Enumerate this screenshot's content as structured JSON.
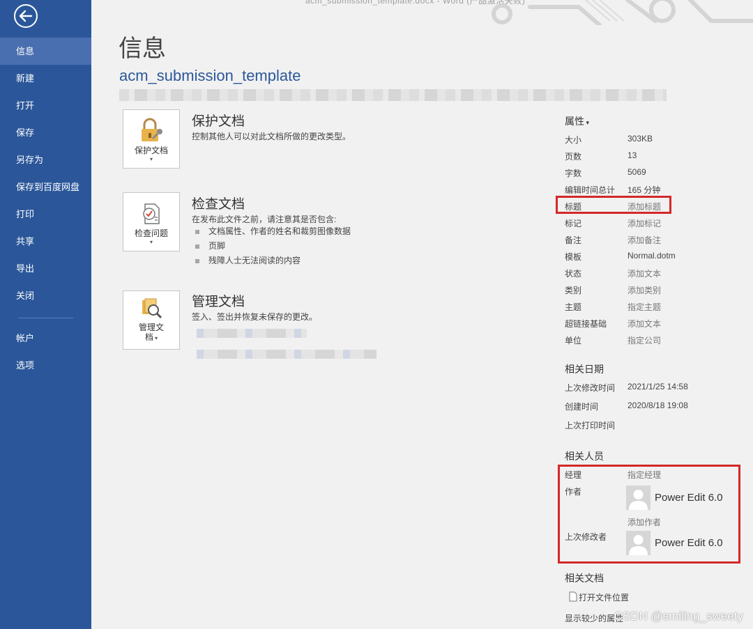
{
  "window_title": "acm_submission_template.docx - Word (产品激活失败)",
  "sidebar": {
    "items": [
      {
        "label": "信息",
        "active": true
      },
      {
        "label": "新建"
      },
      {
        "label": "打开"
      },
      {
        "label": "保存"
      },
      {
        "label": "另存为"
      },
      {
        "label": "保存到百度网盘"
      },
      {
        "label": "打印"
      },
      {
        "label": "共享"
      },
      {
        "label": "导出"
      },
      {
        "label": "关闭"
      }
    ],
    "bottom_items": [
      {
        "label": "帐户"
      },
      {
        "label": "选项"
      }
    ]
  },
  "main": {
    "title": "信息",
    "doc_name": "acm_submission_template",
    "protect": {
      "button": "保护文档",
      "title": "保护文档",
      "desc": "控制其他人可以对此文档所做的更改类型。"
    },
    "inspect": {
      "button": "检查问题",
      "title": "检查文档",
      "desc": "在发布此文件之前，请注意其是否包含:",
      "bullets": [
        "文档属性、作者的姓名和裁剪图像数据",
        "页脚",
        "残障人士无法阅读的内容"
      ]
    },
    "manage": {
      "button_line1": "管理文",
      "button_line2": "档",
      "title": "管理文档",
      "desc": "签入、签出并恢复未保存的更改。"
    }
  },
  "properties": {
    "header": "属性",
    "rows": [
      {
        "key": "大小",
        "value": "303KB"
      },
      {
        "key": "页数",
        "value": "13"
      },
      {
        "key": "字数",
        "value": "5069"
      },
      {
        "key": "编辑时间总计",
        "value": "165 分钟"
      },
      {
        "key": "标题",
        "value": "添加标题",
        "placeholder": true
      },
      {
        "key": "标记",
        "value": "添加标记",
        "placeholder": true
      },
      {
        "key": "备注",
        "value": "添加备注",
        "placeholder": true
      },
      {
        "key": "模板",
        "value": "Normal.dotm"
      },
      {
        "key": "状态",
        "value": "添加文本",
        "placeholder": true
      },
      {
        "key": "类别",
        "value": "添加类别",
        "placeholder": true
      },
      {
        "key": "主题",
        "value": "指定主题",
        "placeholder": true
      },
      {
        "key": "超链接基础",
        "value": "添加文本",
        "placeholder": true
      },
      {
        "key": "单位",
        "value": "指定公司",
        "placeholder": true
      }
    ],
    "dates": {
      "header": "相关日期",
      "rows": [
        {
          "key": "上次修改时间",
          "value": "2021/1/25 14:58"
        },
        {
          "key": "创建时间",
          "value": "2020/8/18 19:08"
        },
        {
          "key": "上次打印时间",
          "value": ""
        }
      ]
    },
    "people": {
      "header": "相关人员",
      "manager_label": "经理",
      "manager_value": "指定经理",
      "author_label": "作者",
      "author_name": "Power Edit 6.0",
      "add_author": "添加作者",
      "modifier_label": "上次修改者",
      "modifier_name": "Power Edit 6.0"
    },
    "docs": {
      "header": "相关文档",
      "open_location": "打开文件位置",
      "show_less": "显示较少的属性"
    }
  },
  "watermark": "CSDN @smiling_sweety",
  "colors": {
    "sidebar": "#2b579a",
    "highlight_box": "#d42828"
  }
}
